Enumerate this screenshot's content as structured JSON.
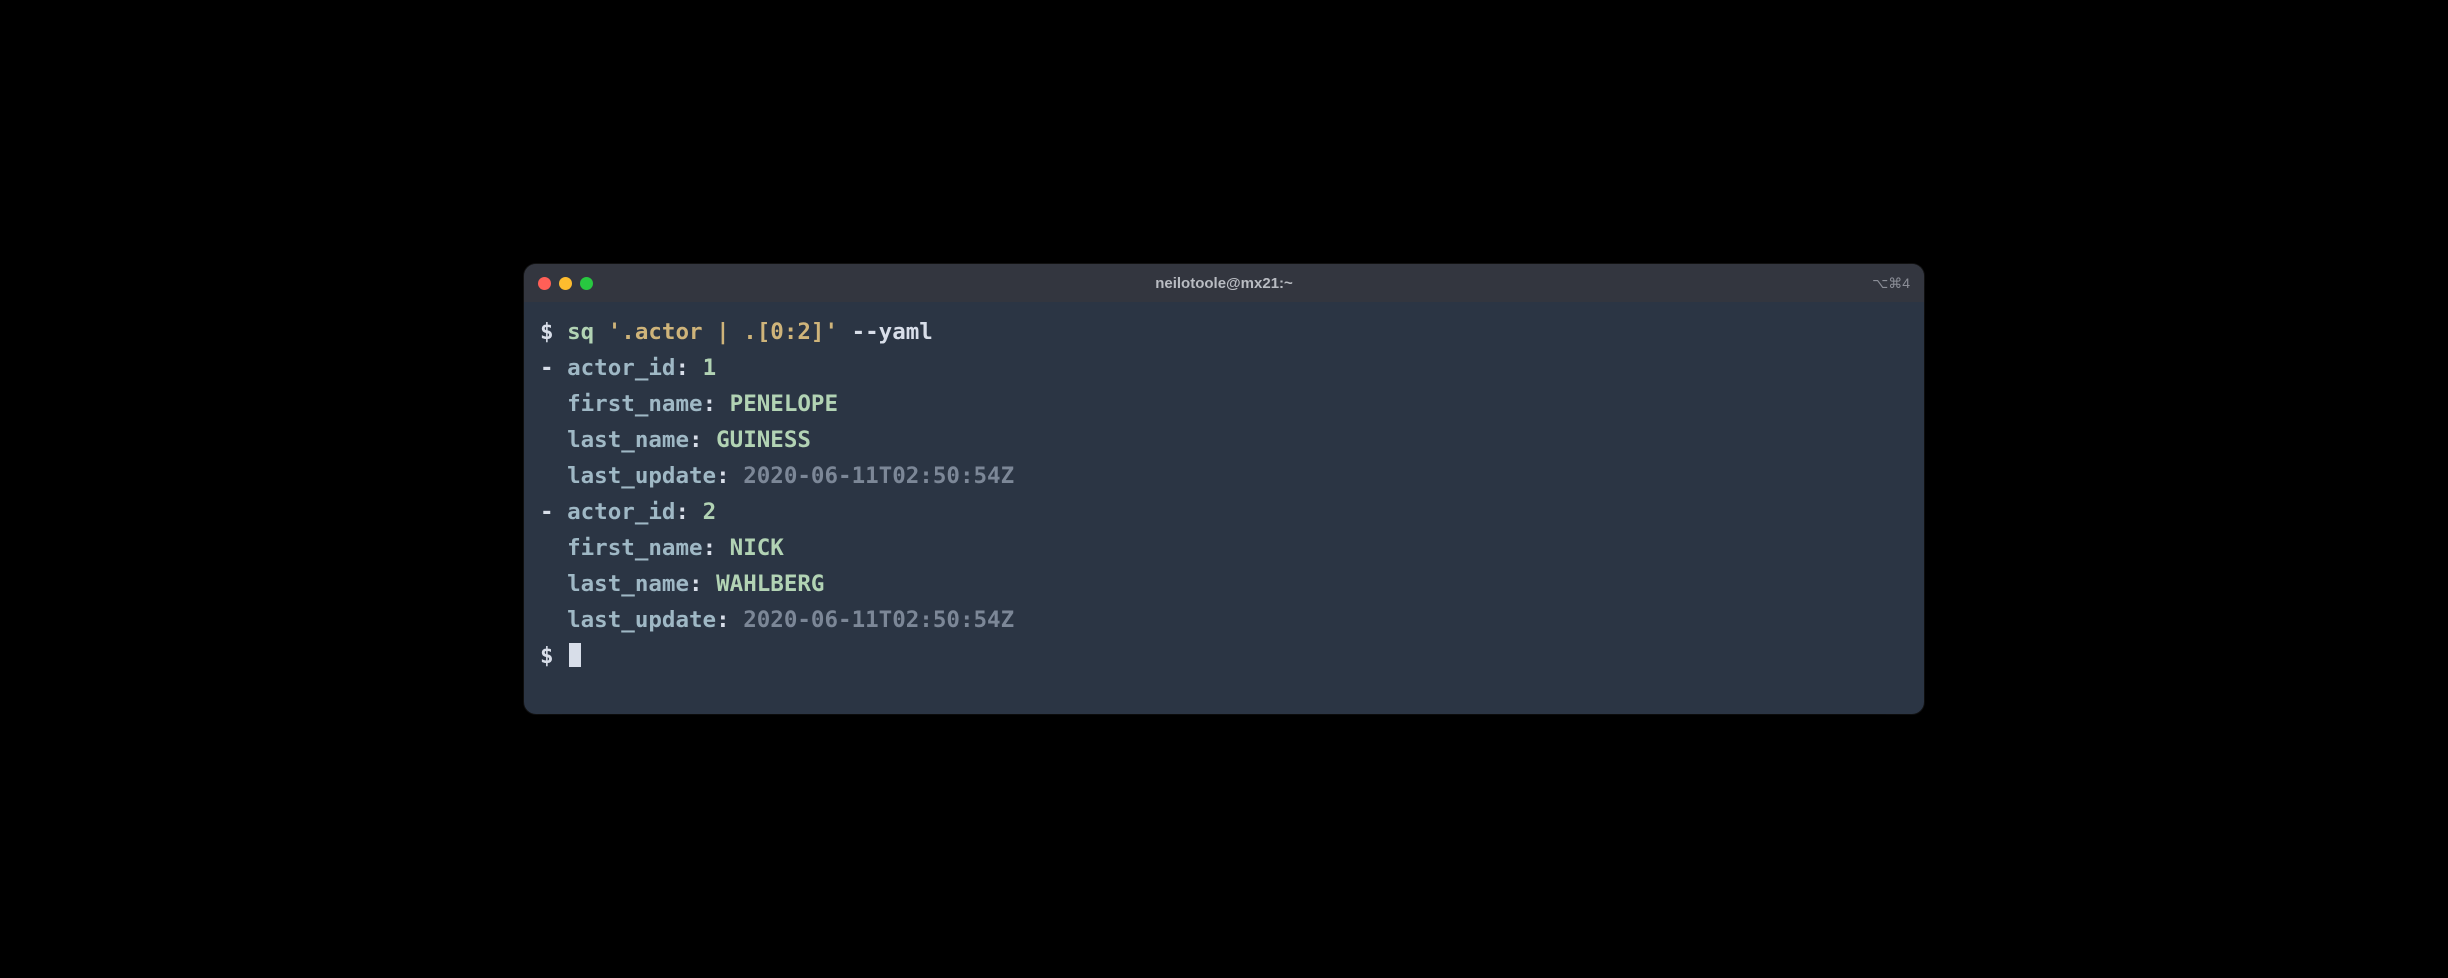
{
  "window": {
    "title": "neilotoole@mx21:~",
    "shortcut_hint": "⌥⌘4"
  },
  "prompt_symbol": "$",
  "command": {
    "bin": "sq",
    "arg": "'.actor | .[0:2]'",
    "flag": "--yaml"
  },
  "output": {
    "records": [
      {
        "actor_id": "1",
        "first_name": "PENELOPE",
        "last_name": "GUINESS",
        "last_update": "2020-06-11T02:50:54Z"
      },
      {
        "actor_id": "2",
        "first_name": "NICK",
        "last_name": "WAHLBERG",
        "last_update": "2020-06-11T02:50:54Z"
      }
    ],
    "keys": {
      "actor_id": "actor_id",
      "first_name": "first_name",
      "last_name": "last_name",
      "last_update": "last_update"
    }
  }
}
